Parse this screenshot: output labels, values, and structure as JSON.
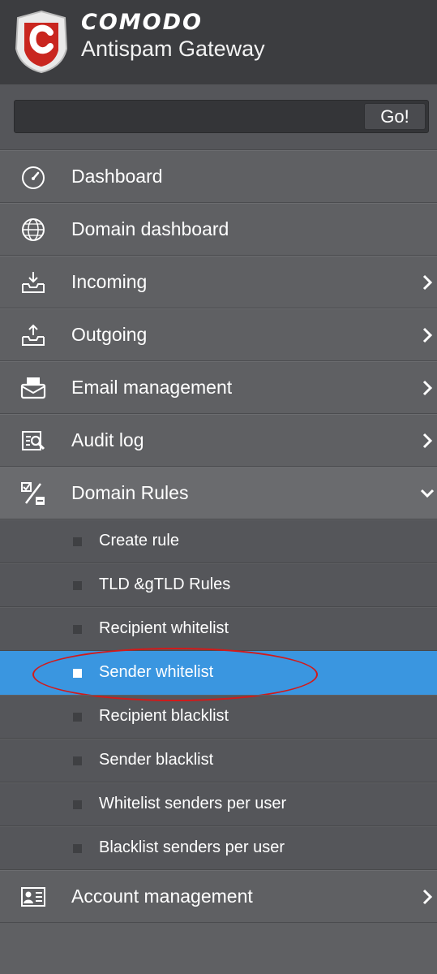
{
  "brand": {
    "name": "COMODO",
    "subtitle": "Antispam Gateway",
    "logo_letter": "C"
  },
  "search": {
    "value": "",
    "placeholder": "",
    "go_label": "Go!"
  },
  "colors": {
    "active": "#3a96e0",
    "sidebar_bg": "#5f6063",
    "highlight": "#d21a1a"
  },
  "menu": [
    {
      "label": "Dashboard",
      "icon": "gauge-icon",
      "has_arrow": false
    },
    {
      "label": "Domain dashboard",
      "icon": "globe-icon",
      "has_arrow": false
    },
    {
      "label": "Incoming",
      "icon": "inbox-download-icon",
      "has_arrow": true
    },
    {
      "label": "Outgoing",
      "icon": "outbox-upload-icon",
      "has_arrow": true
    },
    {
      "label": "Email management",
      "icon": "envelope-tray-icon",
      "has_arrow": true
    },
    {
      "label": "Audit log",
      "icon": "log-search-icon",
      "has_arrow": true
    },
    {
      "label": "Domain Rules",
      "icon": "rules-icon",
      "has_arrow": true,
      "expanded": true
    },
    {
      "label": "Account management",
      "icon": "account-card-icon",
      "has_arrow": true
    }
  ],
  "domain_rules_submenu": [
    {
      "label": "Create rule"
    },
    {
      "label": "TLD &gTLD Rules"
    },
    {
      "label": "Recipient whitelist"
    },
    {
      "label": "Sender whitelist",
      "active": true
    },
    {
      "label": "Recipient blacklist"
    },
    {
      "label": "Sender blacklist"
    },
    {
      "label": "Whitelist senders per user"
    },
    {
      "label": "Blacklist senders per user"
    }
  ]
}
